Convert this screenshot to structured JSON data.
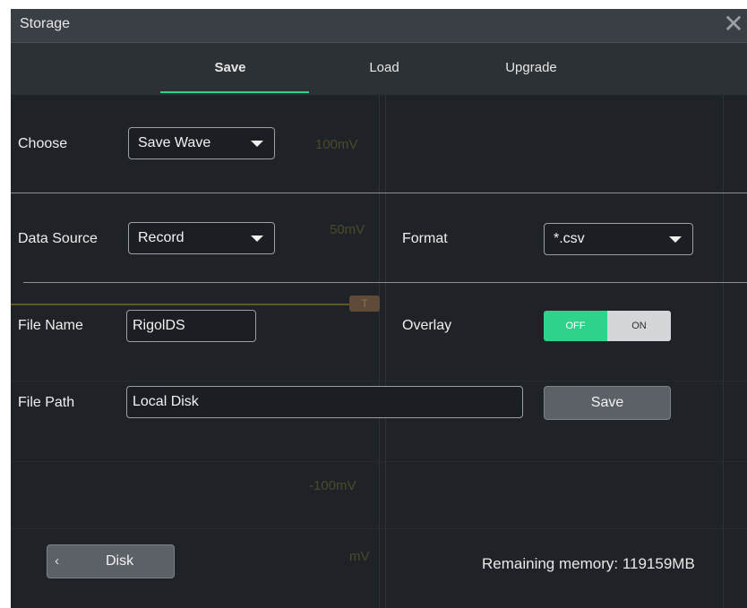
{
  "dialog": {
    "title": "Storage",
    "close_icon": "close-icon"
  },
  "tabs": [
    {
      "label": "Save",
      "active": true
    },
    {
      "label": "Load",
      "active": false
    },
    {
      "label": "Upgrade",
      "active": false
    }
  ],
  "background_scope": {
    "labels": [
      "100mV",
      "50mV",
      "-100mV",
      "mV"
    ],
    "trigger_marker": "T"
  },
  "form": {
    "choose_label": "Choose",
    "choose_value": "Save Wave",
    "data_source_label": "Data Source",
    "data_source_value": "Record",
    "format_label": "Format",
    "format_value": "*.csv",
    "file_name_label": "File Name",
    "file_name_value": "RigolDS",
    "overlay_label": "Overlay",
    "overlay_off": "OFF",
    "overlay_on": "ON",
    "overlay_state": "OFF",
    "file_path_label": "File Path",
    "file_path_value": "Local Disk",
    "save_button": "Save"
  },
  "footer": {
    "disk_button": "Disk",
    "disk_chevron": "‹",
    "remaining_memory": "Remaining memory: 119159MB"
  },
  "colors": {
    "accent": "#2fd28b",
    "dialog_bg": "#1f2327",
    "titlebar_bg": "#3a3f45"
  }
}
